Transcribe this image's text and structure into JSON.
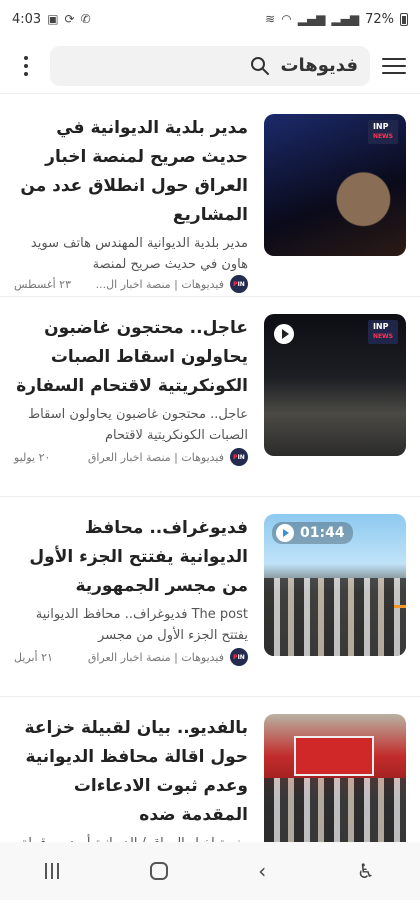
{
  "status": {
    "time": "4:03",
    "battery": "72%"
  },
  "header": {
    "search_text": "فديوهات"
  },
  "articles": [
    {
      "title": "مدير بلدية الديوانية في حديث صريح لمنصة اخبار العراق حول انطلاق عدد من المشاريع",
      "excerpt": "مدير بلدية الديوانية المهندس هاتف سويد هاون في حديث صريح لمنصة",
      "meta": "فيديوهات | منصة اخبار ال...",
      "date": "٢٣ أغسطس",
      "badge": "INP"
    },
    {
      "title": "عاجل.. محتجون غاضبون يحاولون اسقاط الصبات الكونكريتية لاقتحام السفارة",
      "excerpt": "عاجل.. محتجون غاضبون يحاولون اسقاط الصبات الكونكريتية لاقتحام",
      "meta": "فيديوهات | منصة اخبار العراق",
      "date": "٢٠ يوليو",
      "badge": "INP"
    },
    {
      "title": "فديوغراف.. محافظ الديوانية يفتتح الجزء الأول من مجسر الجمهورية",
      "excerpt": "The post فديوغراف.. محافظ الديوانية يفتتح الجزء الأول من مجسر",
      "meta": "فيديوهات | منصة اخبار العراق",
      "date": "٢١ أبريل",
      "duration": "01:44"
    },
    {
      "title": "بالفديو.. بيان لقبيلة خزاعة حول اقالة محافظ الديوانية وعدم ثبوت الادعاءات المقدمة ضده",
      "excerpt": "منصة اخبار العراق / الديوانية أصدرت قبيلة خزاعة في الديوانية اليوم،"
    }
  ],
  "colors": {
    "accent": "#f39a2a",
    "badge_bg": "#20264a"
  }
}
